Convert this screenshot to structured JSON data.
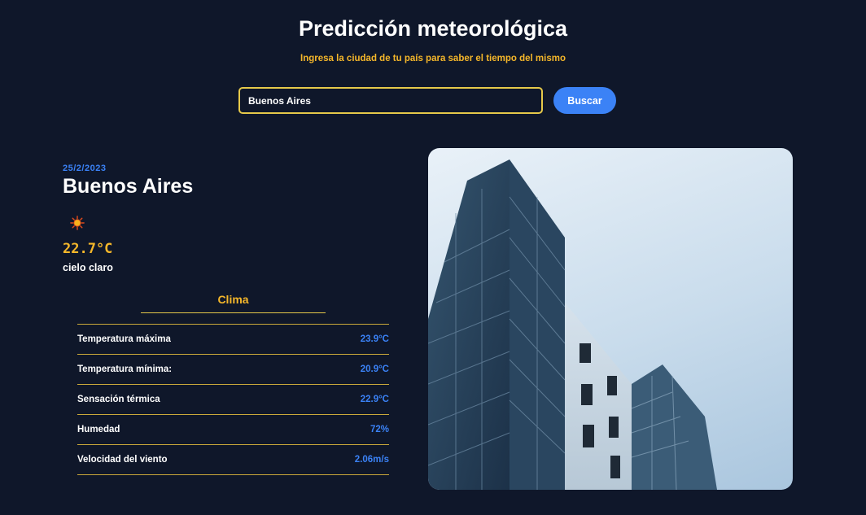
{
  "header": {
    "title": "Predicción meteorológica",
    "subtitle": "Ingresa la ciudad de tu país para saber el tiempo del mismo"
  },
  "search": {
    "value": "Buenos Aires",
    "button_label": "Buscar"
  },
  "weather": {
    "date": "25/2/2023",
    "city": "Buenos Aires",
    "icon": "sun-icon",
    "temperature": "22.7°C",
    "description": "cielo claro"
  },
  "clima": {
    "title": "Clima",
    "rows": [
      {
        "label": "Temperatura máxima",
        "value": "23.9°C"
      },
      {
        "label": "Temperatura mínima:",
        "value": "20.9°C"
      },
      {
        "label": "Sensación térmica",
        "value": "22.9°C"
      },
      {
        "label": "Humedad",
        "value": "72%"
      },
      {
        "label": "Velocidad del viento",
        "value": "2.06m/s"
      }
    ]
  },
  "colors": {
    "background": "#0f172a",
    "accent_yellow": "#f5b72a",
    "accent_blue": "#3b82f6"
  }
}
